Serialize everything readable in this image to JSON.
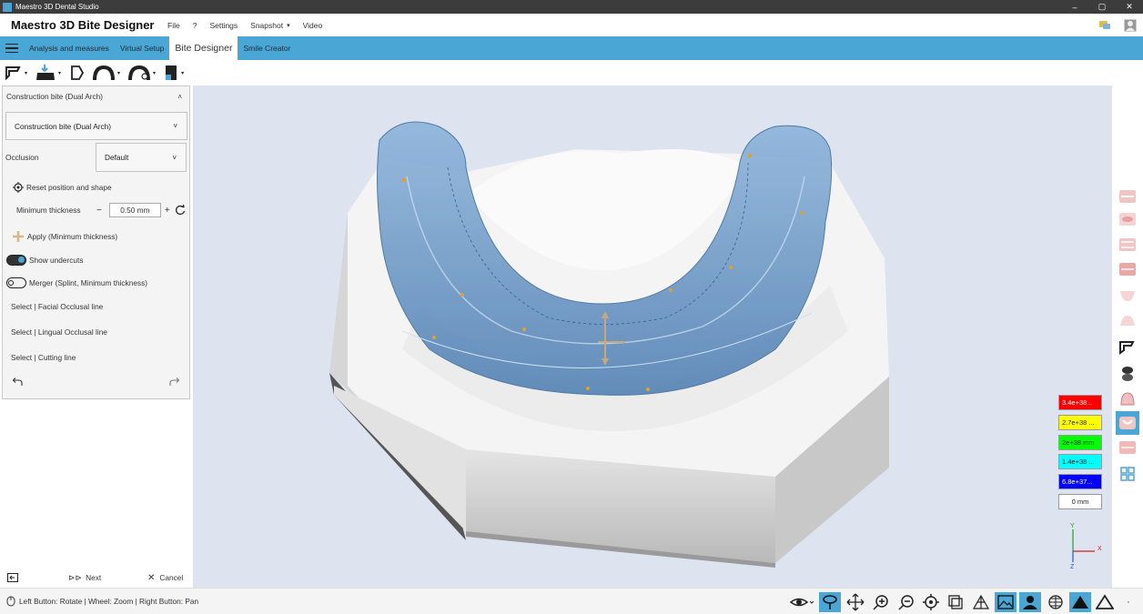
{
  "window": {
    "title": "Maestro 3D Dental Studio",
    "controls": [
      "–",
      "▢",
      "✕"
    ]
  },
  "menubar": {
    "app_title": "Maestro 3D Bite Designer",
    "items": [
      "File",
      "?",
      "Settings",
      "Snapshot",
      "Video"
    ]
  },
  "tabs": {
    "items": [
      {
        "label": "Analysis and measures",
        "active": false
      },
      {
        "label": "Virtual Setup",
        "active": false
      },
      {
        "label": "Bite Designer",
        "active": true
      },
      {
        "label": "Smile Creator",
        "active": false
      }
    ]
  },
  "panel": {
    "header": "Construction bite (Dual Arch)",
    "type_select": "Construction bite (Dual Arch)",
    "occlusion_label": "Occlusion",
    "occlusion_value": "Default",
    "reset_label": "Reset position and shape",
    "min_thickness_label": "Minimum thickness",
    "min_thickness_value": "0.50 mm",
    "minus": "−",
    "plus": "+",
    "apply_label": "Apply (Minimum thickness)",
    "show_undercuts_label": "Show undercuts",
    "show_undercuts_on": true,
    "merger_label": "Merger (Splint, Minimum thickness)",
    "merger_on": false,
    "select_facial": "Select | Facial Occlusal line",
    "select_lingual": "Select | Lingual Occlusal line",
    "select_cutting": "Select | Cutting line"
  },
  "footer": {
    "next_label": "Next",
    "cancel_label": "Cancel"
  },
  "legend": {
    "items": [
      {
        "label": "3.4e+38...",
        "color": "#ff0000",
        "text_color": "#ffffff"
      },
      {
        "label": "2.7e+38 ...",
        "color": "#ffff00",
        "text_color": "#111111"
      },
      {
        "label": "2e+38 mm",
        "color": "#00ff00",
        "text_color": "#111111"
      },
      {
        "label": "1.4e+38 ...",
        "color": "#00ffff",
        "text_color": "#111111"
      },
      {
        "label": "6.8e+37...",
        "color": "#0000ff",
        "text_color": "#ffffff"
      },
      {
        "label": "0 mm",
        "color": "#ffffff",
        "text_color": "#111111"
      }
    ]
  },
  "axes": {
    "y": "Y",
    "x": "X",
    "z": "Z"
  },
  "status": {
    "hint": "Left Button: Rotate | Wheel: Zoom | Right Button: Pan"
  },
  "colors": {
    "accent": "#4aa6d4",
    "viewport_bg": "#dde4ef",
    "splint": "#6f9ccc"
  }
}
